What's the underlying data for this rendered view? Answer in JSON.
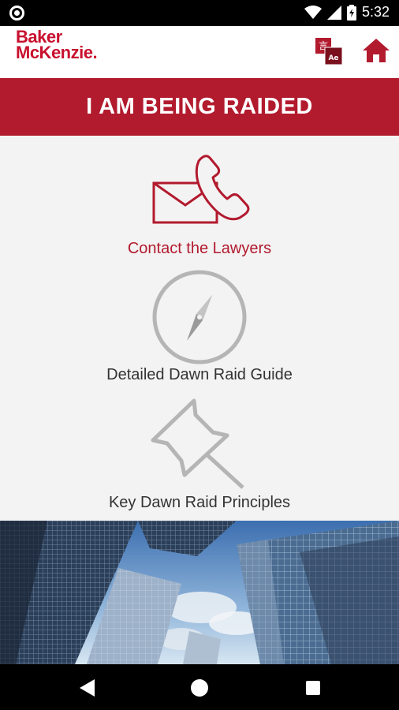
{
  "status_bar": {
    "time": "5:32",
    "icons": [
      "screen-record-icon",
      "wifi-icon",
      "cellular-signal-icon",
      "battery-charging-icon"
    ]
  },
  "header": {
    "logo_line1": "Baker",
    "logo_line2": "McKenzie.",
    "language_icon": "translate-icon",
    "language_icon_chars": [
      "言",
      "Ae"
    ],
    "home_icon": "home-icon"
  },
  "banner": {
    "title": "I AM BEING RAIDED"
  },
  "menu": {
    "items": [
      {
        "label": "Contact the Lawyers",
        "icon": "envelope-phone-icon"
      },
      {
        "label": "Detailed Dawn Raid Guide",
        "icon": "compass-icon"
      },
      {
        "label": "Key Dawn Raid Principles",
        "icon": "pushpin-icon"
      }
    ]
  },
  "footer_image": {
    "subject": "skyscrapers-photo"
  },
  "nav_bar": {
    "buttons": [
      "back-icon",
      "home-circle-icon",
      "recents-icon"
    ]
  },
  "colors": {
    "brand_red": "#b21a2e",
    "background": "#f3f3f3",
    "icon_gray": "#b0b0b0",
    "text_dark": "#333333"
  }
}
